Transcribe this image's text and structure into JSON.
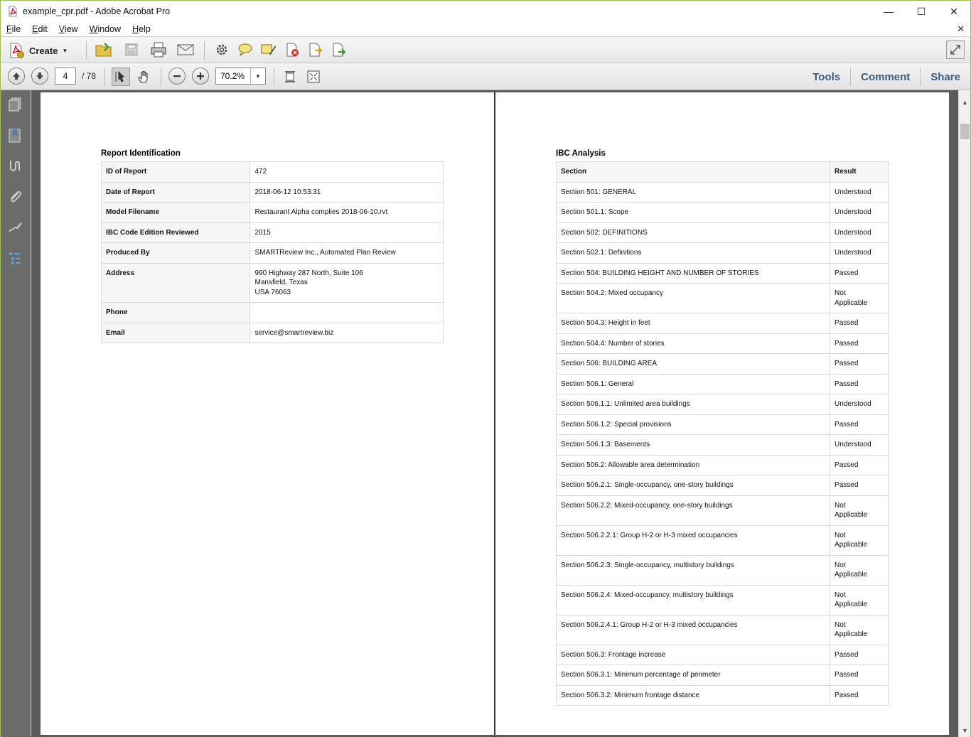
{
  "window": {
    "title": "example_cpr.pdf - Adobe Acrobat Pro",
    "icon": "pdf-file-icon",
    "controls": {
      "minimize": "—",
      "maximize": "☐",
      "close": "✕"
    }
  },
  "menu": {
    "items": [
      {
        "key": "F",
        "rest": "ile"
      },
      {
        "key": "E",
        "rest": "dit"
      },
      {
        "key": "V",
        "rest": "iew"
      },
      {
        "key": "W",
        "rest": "indow"
      },
      {
        "key": "H",
        "rest": "elp"
      }
    ],
    "close_glyph": "✕"
  },
  "toolbar": {
    "create_label": "Create",
    "icons": [
      "open-folder-icon",
      "save-icon",
      "print-icon",
      "email-icon",
      "gear-icon",
      "comment-icon",
      "highlight-icon",
      "delete-pages-icon",
      "export-icon",
      "share-file-icon"
    ]
  },
  "navbar": {
    "current_page": "4",
    "total_pages": "/ 78",
    "zoom": "70.2%",
    "links": {
      "tools": "Tools",
      "comment": "Comment",
      "share": "Share"
    }
  },
  "leftpane": {
    "icons": [
      "pages-icon",
      "bookmarks-icon",
      "signatures-icon",
      "attachments-icon",
      "edit-sign-icon",
      "layers-icon"
    ]
  },
  "report": {
    "heading": "Report Identification",
    "rows": [
      {
        "label": "ID of Report",
        "value": "472"
      },
      {
        "label": "Date of Report",
        "value": "2018-06-12 10:53:31"
      },
      {
        "label": "Model Filename",
        "value": "Restaurant Alpha complies 2018-06-10.rvt"
      },
      {
        "label": "IBC Code Edition Reviewed",
        "value": "2015"
      },
      {
        "label": "Produced By",
        "value": "SMARTReview Inc., Automated Plan Review"
      },
      {
        "label": "Address",
        "value": "990 Highway 287 North, Suite 106\nMansfield, Texas\nUSA 76063"
      },
      {
        "label": "Phone",
        "value": ""
      },
      {
        "label": "Email",
        "value": "service@smartreview.biz"
      }
    ]
  },
  "ibc": {
    "heading": "IBC Analysis",
    "columns": [
      "Section",
      "Result"
    ],
    "rows": [
      [
        "Section 501: GENERAL",
        "Understood"
      ],
      [
        "Section 501.1: Scope",
        "Understood"
      ],
      [
        "Section 502: DEFINITIONS",
        "Understood"
      ],
      [
        "Section 502.1: Definitions",
        "Understood"
      ],
      [
        "Section 504: BUILDING HEIGHT AND NUMBER OF STORIES",
        "Passed"
      ],
      [
        "Section 504.2: Mixed occupancy",
        "Not\nApplicable"
      ],
      [
        "Section 504.3: Height in feet",
        "Passed"
      ],
      [
        "Section 504.4: Number of stories",
        "Passed"
      ],
      [
        "Section 506: BUILDING AREA",
        "Passed"
      ],
      [
        "Section 506.1: General",
        "Passed"
      ],
      [
        "Section 506.1.1: Unlimited area buildings",
        "Understood"
      ],
      [
        "Section 506.1.2: Special provisions",
        "Passed"
      ],
      [
        "Section 506.1.3: Basements",
        "Understood"
      ],
      [
        "Section 506.2: Allowable area determination",
        "Passed"
      ],
      [
        "Section 506.2.1: Single-occupancy, one-story buildings",
        "Passed"
      ],
      [
        "Section 506.2.2: Mixed-occupancy, one-story buildings",
        "Not\nApplicable"
      ],
      [
        "Section 506.2.2.1: Group H-2 or H-3 mixed occupancies",
        "Not\nApplicable"
      ],
      [
        "Section 506.2.3: Single-occupancy, multistory buildings",
        "Not\nApplicable"
      ],
      [
        "Section 506.2.4: Mixed-occupancy, multistory buildings",
        "Not\nApplicable"
      ],
      [
        "Section 506.2.4.1: Group H-2 or H-3 mixed occupancies",
        "Not\nApplicable"
      ],
      [
        "Section 506.3: Frontage increase",
        "Passed"
      ],
      [
        "Section 506.3.1: Minimum percentage of perimeter",
        "Passed"
      ],
      [
        "Section 506.3.2: Minimum frontage distance",
        "Passed"
      ]
    ]
  }
}
